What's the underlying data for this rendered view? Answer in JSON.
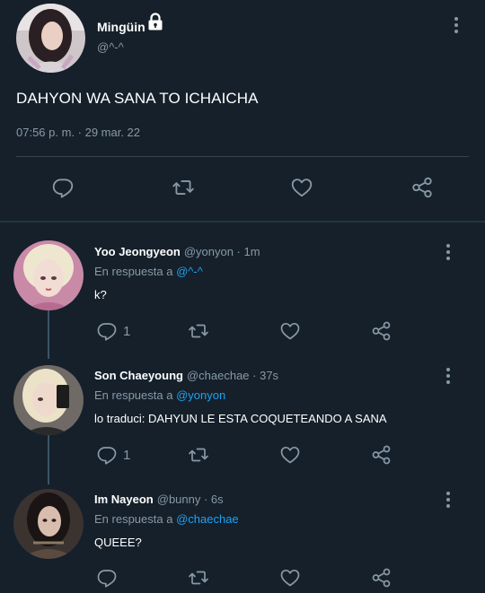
{
  "tweet": {
    "author_name": "Mingüin",
    "author_handle": "@^-^",
    "text": "DAHYON WA SANA TO ICHAICHA",
    "timestamp": "07:56 p. m. · 29 mar. 22"
  },
  "replies": [
    {
      "name": "Yoo Jeongyeon",
      "meta": "@yonyon · 1m",
      "reply_prefix": "En respuesta a",
      "reply_mention": "@^-^",
      "text": "k?",
      "reply_count": "1"
    },
    {
      "name": "Son Chaeyoung",
      "meta": "@chaechae · 37s",
      "reply_prefix": "En respuesta a",
      "reply_mention": "@yonyon",
      "text": "lo traduci: DAHYUN LE ESTA COQUETEANDO A SANA",
      "reply_count": "1"
    },
    {
      "name": "Im Nayeon",
      "meta": "@bunny · 6s",
      "reply_prefix": "En respuesta a",
      "reply_mention": "@chaechae",
      "text": "QUEEE?",
      "reply_count": ""
    }
  ],
  "colors": {
    "background": "#15202b",
    "text_secondary": "#8899a6",
    "mention": "#1da1f2",
    "divider": "#38444d"
  },
  "icons": [
    "lock-icon",
    "more-icon",
    "reply-icon",
    "retweet-icon",
    "like-icon",
    "share-icon"
  ]
}
